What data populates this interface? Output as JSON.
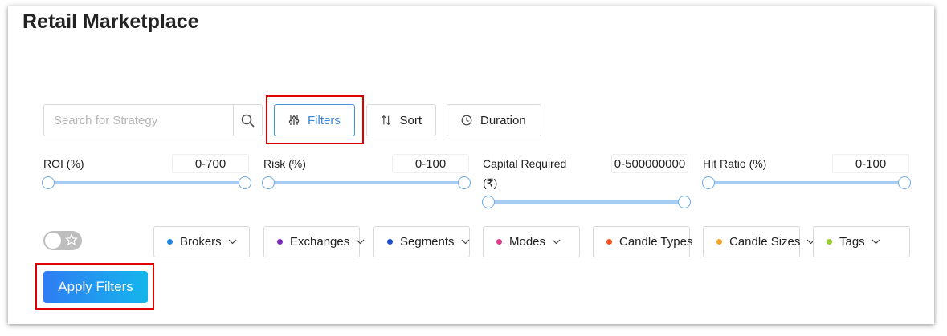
{
  "page": {
    "title": "Retail Marketplace"
  },
  "search": {
    "placeholder": "Search for Strategy",
    "icon": "search-icon"
  },
  "toolbar": {
    "filters_label": "Filters",
    "sort_label": "Sort",
    "duration_label": "Duration"
  },
  "ranges": [
    {
      "label": "ROI (%)",
      "value": "0-700"
    },
    {
      "label": "Risk (%)",
      "value": "0-100"
    },
    {
      "label": "Capital Required",
      "label_line2": "(₹)",
      "value": "0-500000000"
    },
    {
      "label": "Hit Ratio (%)",
      "value": "0-100"
    }
  ],
  "favorites_toggle": {
    "on": false,
    "icon": "star-icon"
  },
  "dropdowns": [
    {
      "label": "Brokers",
      "color": "#1e88e5"
    },
    {
      "label": "Exchanges",
      "color": "#7b2cbf"
    },
    {
      "label": "Segments",
      "color": "#1e50d6"
    },
    {
      "label": "Modes",
      "color": "#e03c8a"
    },
    {
      "label": "Candle Types",
      "color": "#f4511e"
    },
    {
      "label": "Candle Sizes",
      "color": "#f5a623"
    },
    {
      "label": "Tags",
      "color": "#9acd32"
    }
  ],
  "apply": {
    "label": "Apply Filters"
  },
  "colors": {
    "accent": "#3a85d8",
    "highlight": "#e00000",
    "track": "#a7cdf4"
  }
}
